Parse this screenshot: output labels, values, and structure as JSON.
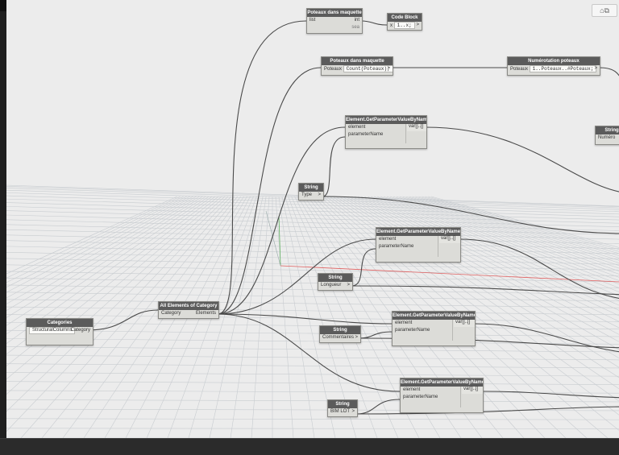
{
  "view_control": {
    "icons": "cube-icon window-icon",
    "label": "⌂⧉"
  },
  "nodes": {
    "poteaux_list": {
      "title": "Poteaux dans maquette",
      "in": "list",
      "out": "int",
      "foot": "sea"
    },
    "code_block": {
      "title": "Code Block",
      "in": "x",
      "value": "1..x;",
      "out": ">"
    },
    "poteaux_count": {
      "title": "Poteaux dans maquette",
      "in": "Poteaux",
      "value": "Count(Poteaux);",
      "out": ">"
    },
    "numerotation": {
      "title": "Numérotation poteaux",
      "in": "Poteaux",
      "value": "1..Poteaux..#Poteaux;",
      "out": ">"
    },
    "string_numero": {
      "title": "String",
      "value": "Numéro"
    },
    "gpv1": {
      "title": "Element.GetParameterValueByName",
      "in1": "element",
      "in2": "parameterName",
      "out": "var[]..[]"
    },
    "string_type": {
      "title": "String",
      "value": "Type",
      "out": ">"
    },
    "gpv2": {
      "title": "Element.GetParameterValueByName",
      "in1": "element",
      "in2": "parameterName",
      "out": "var[]..[]"
    },
    "string_longueur": {
      "title": "String",
      "value": "Longueur",
      "out": ">"
    },
    "all_elements": {
      "title": "All Elements of Category",
      "in": "Category",
      "out": "Elements"
    },
    "categories": {
      "title": "Categories",
      "value": "StructuralColumns",
      "out": "Category"
    },
    "gpv3": {
      "title": "Element.GetParameterValueByName",
      "in1": "element",
      "in2": "parameterName",
      "out": "var[]..[]"
    },
    "string_comment": {
      "title": "String",
      "value": "Commentaires",
      "out": ">"
    },
    "gpv4": {
      "title": "Element.GetParameterValueByName",
      "in1": "element",
      "in2": "parameterName",
      "out": "var[]..[]"
    },
    "string_bimlot": {
      "title": "String",
      "value": "BIM LOT",
      "out": ">"
    }
  },
  "colors": {
    "canvas": "#ececec",
    "grid": "#c8ccd0",
    "wire": "#4a4a4a",
    "node_header": "#5b5b5b",
    "node_body": "#dcdcd8",
    "axis_red": "#e06060",
    "axis_green": "#60b060"
  }
}
